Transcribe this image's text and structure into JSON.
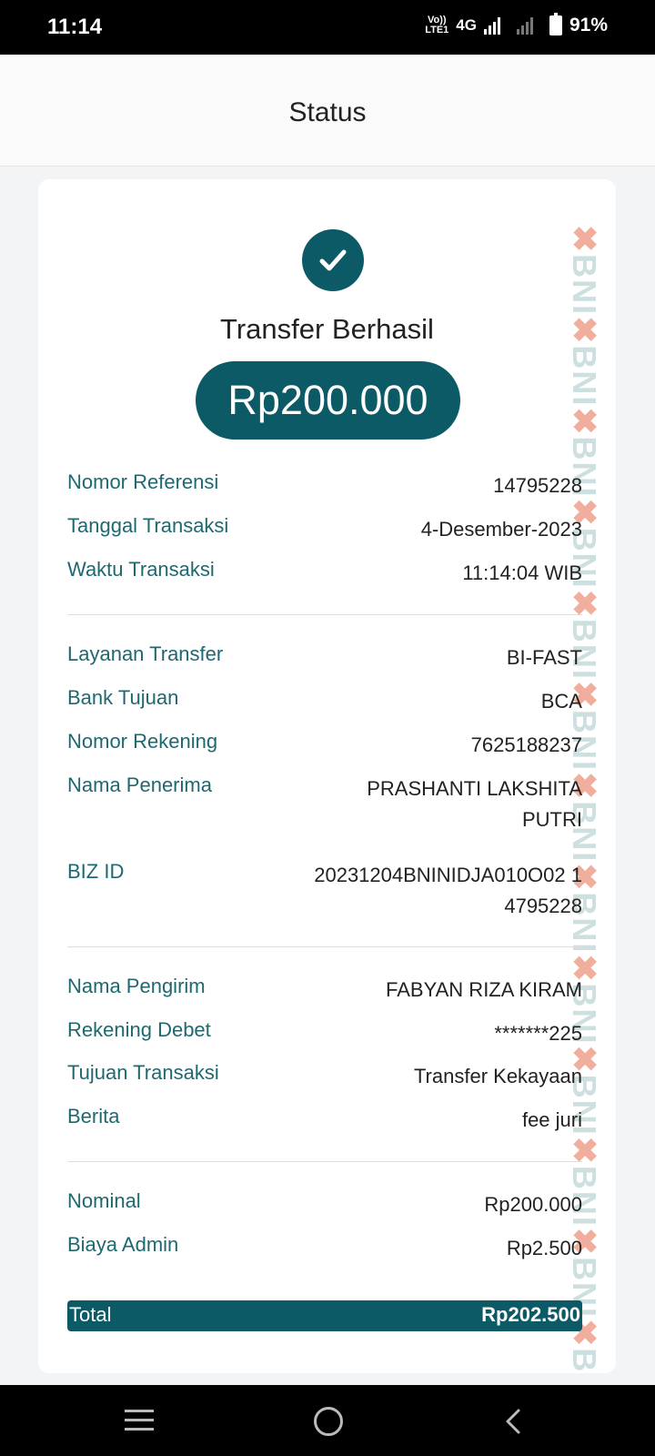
{
  "status_bar": {
    "time": "11:14",
    "volte_top": "Vo))",
    "volte_bottom": "LTE1",
    "network": "4G",
    "battery": "91%"
  },
  "header": {
    "title": "Status"
  },
  "receipt": {
    "status": "Transfer Berhasil",
    "amount": "Rp200.000",
    "watermark": "BNI",
    "section1": [
      {
        "label": "Nomor Referensi",
        "value": "14795228"
      },
      {
        "label": "Tanggal Transaksi",
        "value": "4-Desember-2023"
      },
      {
        "label": "Waktu Transaksi",
        "value": "11:14:04 WIB"
      }
    ],
    "section2": [
      {
        "label": "Layanan Transfer",
        "value": "BI-FAST"
      },
      {
        "label": "Bank Tujuan",
        "value": "BCA"
      },
      {
        "label": "Nomor Rekening",
        "value": "7625188237"
      },
      {
        "label": "Nama Penerima",
        "value": "PRASHANTI LAKSHITA PUTRI"
      },
      {
        "label": "BIZ ID",
        "value": "20231204BNINIDJA010O02 14795228"
      }
    ],
    "section3": [
      {
        "label": "Nama Pengirim",
        "value": "FABYAN RIZA KIRAM"
      },
      {
        "label": "Rekening Debet",
        "value": "*******225"
      },
      {
        "label": "Tujuan Transaksi",
        "value": "Transfer Kekayaan"
      },
      {
        "label": "Berita",
        "value": "fee juri"
      }
    ],
    "section4": [
      {
        "label": "Nominal",
        "value": "Rp200.000"
      },
      {
        "label": "Biaya Admin",
        "value": "Rp2.500"
      }
    ],
    "total": {
      "label": "Total",
      "value": "Rp202.500"
    }
  },
  "colors": {
    "accent": "#0b5a66",
    "label": "#1e6870"
  },
  "nav_icons": [
    "menu-icon",
    "home-icon",
    "back-icon"
  ]
}
